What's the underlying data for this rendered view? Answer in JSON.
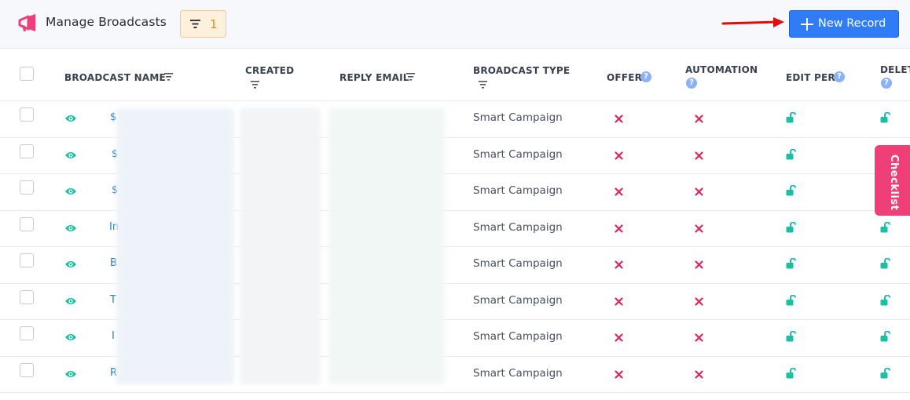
{
  "header": {
    "title": "Manage Broadcasts",
    "filter_count": "1",
    "new_record_label": "New Record"
  },
  "table": {
    "columns": [
      {
        "label": "BROADCAST NAME"
      },
      {
        "label": "CREATED"
      },
      {
        "label": "REPLY EMAIL"
      },
      {
        "label": "BROADCAST TYPE"
      },
      {
        "label": "OFFER"
      },
      {
        "label": "AUTOMATION"
      },
      {
        "label": "EDIT PER."
      },
      {
        "label": "DELETE"
      }
    ],
    "rows": [
      {
        "name_prefix": "$",
        "type": "Smart Campaign"
      },
      {
        "name_prefix": "$",
        "type": "Smart Campaign"
      },
      {
        "name_prefix": "$",
        "type": "Smart Campaign"
      },
      {
        "name_prefix": "In",
        "type": "Smart Campaign"
      },
      {
        "name_prefix": "B",
        "type": "Smart Campaign"
      },
      {
        "name_prefix": "T",
        "type": "Smart Campaign"
      },
      {
        "name_prefix": "I",
        "type": "Smart Campaign"
      },
      {
        "name_prefix": "R",
        "type": "Smart Campaign"
      }
    ]
  },
  "checklist_label": "Checklist",
  "colors": {
    "accent": "#2f7cf6",
    "teal": "#1bbfa3",
    "cross": "#e0245e",
    "checklist": "#ef3f79"
  }
}
